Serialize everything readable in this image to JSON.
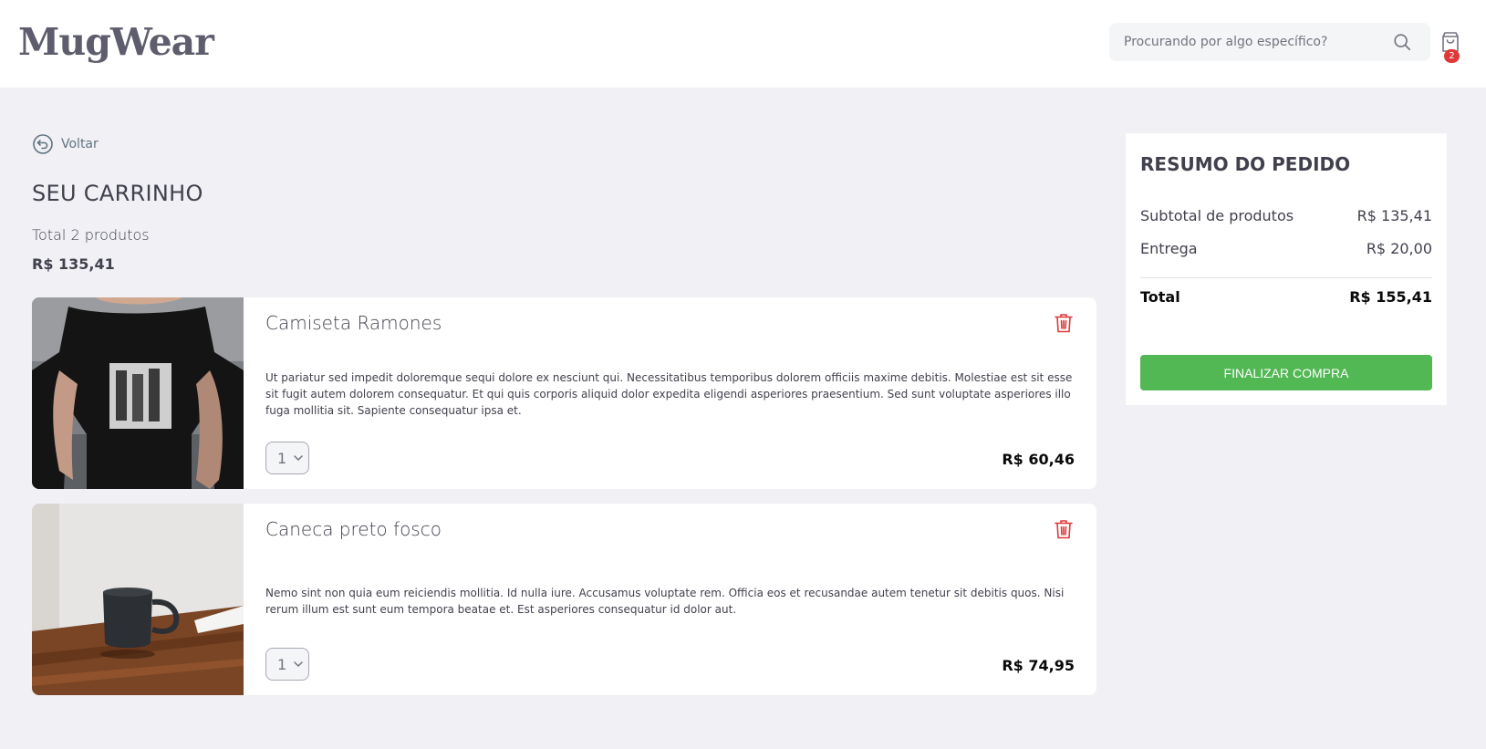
{
  "header": {
    "logo": "MugWear",
    "search_placeholder": "Procurando por algo específico?",
    "cart_count": "2"
  },
  "back": {
    "label": "Voltar"
  },
  "cart": {
    "title": "SEU CARRINHO",
    "total_count": "Total 2 produtos",
    "total_value": "R$ 135,41",
    "items": [
      {
        "name": "Camiseta Ramones",
        "description": "Ut pariatur sed impedit doloremque sequi dolore ex nesciunt qui. Necessitatibus temporibus dolorem officiis maxime debitis. Molestiae est sit esse sit fugit autem dolorem consequatur. Et qui quis corporis aliquid dolor expedita eligendi asperiores praesentium. Sed sunt voluptate asperiores illo fuga mollitia sit. Sapiente consequatur ipsa et.",
        "quantity": "1",
        "price": "R$ 60,46",
        "image_alt": "Camiseta Ramones"
      },
      {
        "name": "Caneca preto fosco",
        "description": "Nemo sint non quia eum reiciendis mollitia. Id nulla iure. Accusamus voluptate rem. Officia eos et recusandae autem tenetur sit debitis quos. Nisi rerum illum est sunt eum tempora beatae et. Est asperiores consequatur id dolor aut.",
        "quantity": "1",
        "price": "R$ 74,95",
        "image_alt": "Caneca preto fosco"
      }
    ]
  },
  "summary": {
    "title": "RESUMO DO PEDIDO",
    "subtotal_label": "Subtotal de produtos",
    "subtotal_value": "R$ 135,41",
    "delivery_label": "Entrega",
    "delivery_value": "R$ 20,00",
    "total_label": "Total",
    "total_value": "R$ 155,41",
    "checkout_label": "FINALIZAR COMPRA"
  },
  "colors": {
    "background": "#f0f0f5",
    "checkout": "#51b853",
    "delete": "#de3838",
    "badge": "#de3838"
  },
  "icons": [
    "search-icon",
    "shopping-bag-icon",
    "back-arrow-icon",
    "trash-icon",
    "chevron-down-icon"
  ]
}
